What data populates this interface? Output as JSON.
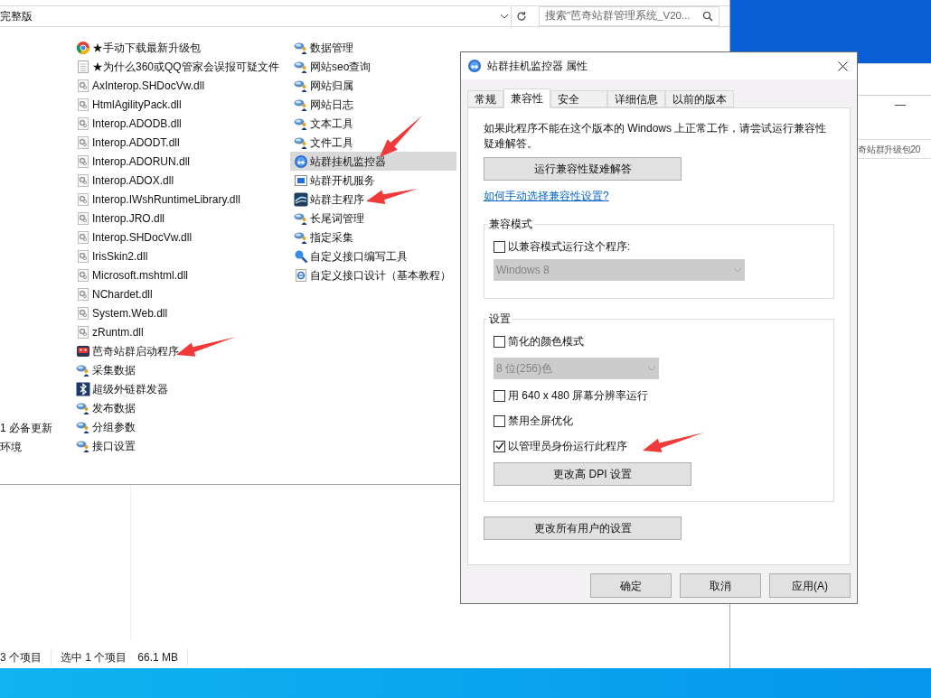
{
  "explorer": {
    "address": "完整版",
    "search": {
      "placeholder": "搜索\"芭奇站群管理系统_V20..."
    },
    "nav_items": [
      "1 必备更新",
      "环境"
    ],
    "columns": [
      [
        {
          "name": "★手动下载最新升级包",
          "kind": "web",
          "selected": false
        },
        {
          "name": "★为什么360或QQ管家会误报可疑文件",
          "kind": "text",
          "selected": false
        },
        {
          "name": "AxInterop.SHDocVw.dll",
          "kind": "dll",
          "selected": false
        },
        {
          "name": "HtmlAgilityPack.dll",
          "kind": "dll",
          "selected": false
        },
        {
          "name": "Interop.ADODB.dll",
          "kind": "dll",
          "selected": false
        },
        {
          "name": "Interop.ADODT.dll",
          "kind": "dll",
          "selected": false
        },
        {
          "name": "Interop.ADORUN.dll",
          "kind": "dll",
          "selected": false
        },
        {
          "name": "Interop.ADOX.dll",
          "kind": "dll",
          "selected": false
        },
        {
          "name": "Interop.IWshRuntimeLibrary.dll",
          "kind": "dll",
          "selected": false
        },
        {
          "name": "Interop.JRO.dll",
          "kind": "dll",
          "selected": false
        },
        {
          "name": "Interop.SHDocVw.dll",
          "kind": "dll",
          "selected": false
        },
        {
          "name": "IrisSkin2.dll",
          "kind": "dll",
          "selected": false
        },
        {
          "name": "Microsoft.mshtml.dll",
          "kind": "dll",
          "selected": false
        },
        {
          "name": "NChardet.dll",
          "kind": "dll",
          "selected": false
        },
        {
          "name": "System.Web.dll",
          "kind": "dll",
          "selected": false
        },
        {
          "name": "zRuntm.dll",
          "kind": "dll",
          "selected": false
        },
        {
          "name": "芭奇站群启动程序",
          "kind": "launcher",
          "selected": false
        },
        {
          "name": "采集数据",
          "kind": "network",
          "selected": false
        },
        {
          "name": "超级外链群发器",
          "kind": "sender",
          "selected": false
        },
        {
          "name": "发布数据",
          "kind": "network",
          "selected": false
        },
        {
          "name": "分组参数",
          "kind": "network",
          "selected": false
        },
        {
          "name": "接口设置",
          "kind": "network",
          "selected": false
        }
      ],
      [
        {
          "name": "数据管理",
          "kind": "network",
          "selected": false
        },
        {
          "name": "网站seo查询",
          "kind": "network",
          "selected": false
        },
        {
          "name": "网站归属",
          "kind": "network",
          "selected": false
        },
        {
          "name": "网站日志",
          "kind": "network",
          "selected": false
        },
        {
          "name": "文本工具",
          "kind": "network",
          "selected": false
        },
        {
          "name": "文件工具",
          "kind": "network",
          "selected": false
        },
        {
          "name": "站群挂机监控器",
          "kind": "monitor",
          "selected": true
        },
        {
          "name": "站群开机服务",
          "kind": "service",
          "selected": false
        },
        {
          "name": "站群主程序",
          "kind": "program",
          "selected": false
        },
        {
          "name": "长尾词管理",
          "kind": "network",
          "selected": false
        },
        {
          "name": "指定采集",
          "kind": "network",
          "selected": false
        },
        {
          "name": "自定义接口编写工具",
          "kind": "search-tool",
          "selected": false
        },
        {
          "name": "自定义接口设计（基本教程）",
          "kind": "webpage",
          "selected": false
        }
      ]
    ],
    "status_bar": [
      "3 个项目",
      "选中 1 个项目",
      "66.1 MB"
    ]
  },
  "background_window": {
    "field": "奇站群升级包20"
  },
  "dialog": {
    "title": "站群挂机监控器 属性",
    "tabs": [
      {
        "label": "常规",
        "selected": false
      },
      {
        "label": "兼容性",
        "selected": true
      },
      {
        "label": "安全",
        "selected": false
      },
      {
        "label": "详细信息",
        "selected": false
      },
      {
        "label": "以前的版本",
        "selected": false
      }
    ],
    "intro": "如果此程序不能在这个版本的 Windows 上正常工作，请尝试运行兼容性疑难解答。",
    "troubleshoot_button": "运行兼容性疑难解答",
    "help_link": "如何手动选择兼容性设置?",
    "groups": [
      {
        "title": "兼容模式",
        "items": [
          {
            "kind": "checkbox",
            "label": "以兼容模式运行这个程序:",
            "checked": false
          },
          {
            "kind": "select",
            "value": "Windows 8",
            "disabled": true
          }
        ]
      },
      {
        "title": "设置",
        "items": [
          {
            "kind": "checkbox",
            "label": "简化的颜色模式",
            "checked": false
          },
          {
            "kind": "select",
            "value": "8 位(256)色",
            "disabled": true
          },
          {
            "kind": "checkbox",
            "label": "用 640 x 480 屏幕分辨率运行",
            "checked": false
          },
          {
            "kind": "checkbox",
            "label": "禁用全屏优化",
            "checked": false
          },
          {
            "kind": "checkbox",
            "label": "以管理员身份运行此程序",
            "checked": true
          },
          {
            "kind": "button",
            "label": "更改高 DPI 设置"
          }
        ]
      }
    ],
    "all_users_button": "更改所有用户的设置",
    "buttons": [
      "确定",
      "取消",
      "应用(A)"
    ]
  }
}
